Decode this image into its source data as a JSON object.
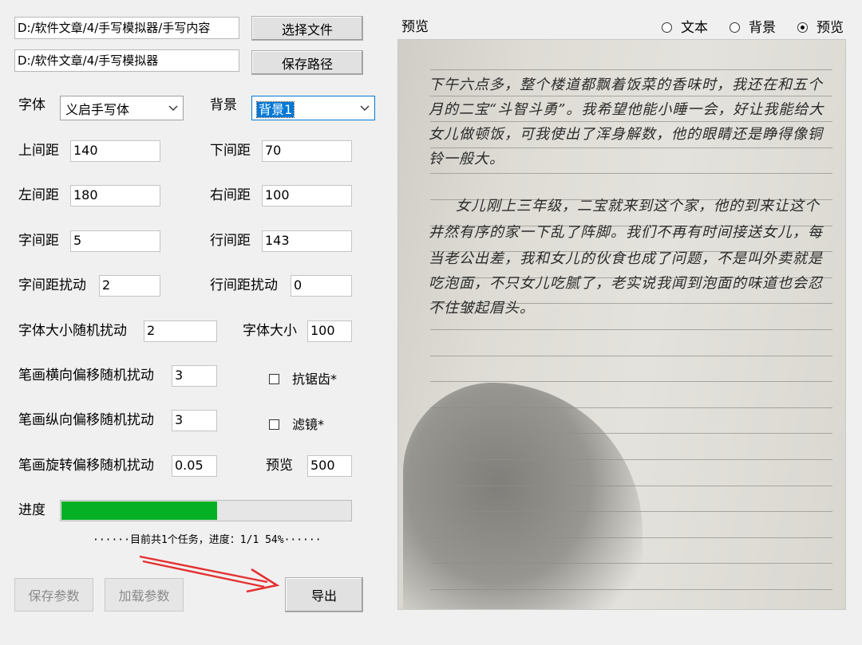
{
  "file": {
    "input_path": "D:/软件文章/4/手写模拟器/手写内容",
    "select_button": "选择文件",
    "save_path": "D:/软件文章/4/手写模拟器",
    "save_path_button": "保存路径"
  },
  "font": {
    "label": "字体",
    "value": "义启手写体"
  },
  "background": {
    "label": "背景",
    "value": "背景1"
  },
  "params": {
    "top_margin": {
      "label": "上间距",
      "value": "140"
    },
    "bottom_margin": {
      "label": "下间距",
      "value": "70"
    },
    "left_margin": {
      "label": "左间距",
      "value": "180"
    },
    "right_margin": {
      "label": "右间距",
      "value": "100"
    },
    "char_spacing": {
      "label": "字间距",
      "value": "5"
    },
    "line_spacing": {
      "label": "行间距",
      "value": "143"
    },
    "char_spacing_jitter": {
      "label": "字间距扰动",
      "value": "2"
    },
    "line_spacing_jitter": {
      "label": "行间距扰动",
      "value": "0"
    },
    "font_size_jitter": {
      "label": "字体大小随机扰动",
      "value": "2"
    },
    "font_size": {
      "label": "字体大小",
      "value": "100"
    },
    "stroke_h_jitter": {
      "label": "笔画横向偏移随机扰动",
      "value": "3"
    },
    "stroke_v_jitter": {
      "label": "笔画纵向偏移随机扰动",
      "value": "3"
    },
    "stroke_rot_jitter": {
      "label": "笔画旋转偏移随机扰动",
      "value": "0.05"
    },
    "preview": {
      "label": "预览",
      "value": "500"
    }
  },
  "options": {
    "antialias": {
      "label": "抗锯齿*",
      "checked": false
    },
    "filter": {
      "label": "滤镜*",
      "checked": false
    }
  },
  "progress": {
    "label": "进度",
    "percent": 54,
    "status": "······目前共1个任务，进度：1/1 54%······"
  },
  "buttons": {
    "save_params": "保存参数",
    "load_params": "加载参数",
    "export": "导出"
  },
  "preview_panel": {
    "title": "预览",
    "modes": [
      {
        "label": "文本",
        "checked": false
      },
      {
        "label": "背景",
        "checked": false
      },
      {
        "label": "预览",
        "checked": true
      }
    ],
    "lines": [
      "下午六点多，整个楼道都飘着饭菜的香味时，我还在和五个",
      "月的二宝“斗智斗勇”。我希望他能小睡一会，好让我能给大",
      "女儿做顿饭，可我使出了浑身解数，他的眼睛还是睁得像铜",
      "铃一般大。",
      "女儿刚上三年级，二宝就来到这个家，他的到来让这个",
      "井然有序的家一下乱了阵脚。我们不再有时间接送女儿，每",
      "当老公出差，我和女儿的伙食也成了问题，不是叫外卖就是",
      "吃泡面，不只女儿吃腻了，老实说我闻到泡面的味道也会忍",
      "不住皱起眉头。"
    ]
  },
  "colors": {
    "accent": "#0078d7",
    "progress": "#06b025",
    "arrow": "#e53030"
  }
}
